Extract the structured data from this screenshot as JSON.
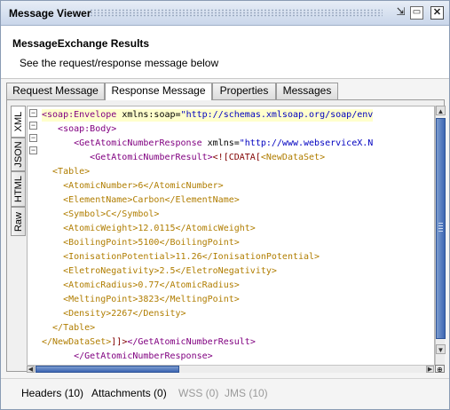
{
  "window": {
    "title": "Message Viewer",
    "detach_glyph": "⇲",
    "maximize_glyph": "▭",
    "close_glyph": "✕"
  },
  "header": {
    "title": "MessageExchange Results",
    "subtitle": "See the request/response message below"
  },
  "tabs": [
    {
      "label": "Request Message",
      "active": false
    },
    {
      "label": "Response Message",
      "active": true
    },
    {
      "label": "Properties",
      "active": false
    },
    {
      "label": "Messages",
      "active": false
    }
  ],
  "view_tabs": [
    {
      "label": "XML",
      "active": true
    },
    {
      "label": "JSON",
      "active": false
    },
    {
      "label": "HTML",
      "active": false
    },
    {
      "label": "Raw",
      "active": false
    }
  ],
  "code_lines": [
    {
      "parts": [
        {
          "c": "tag",
          "t": "<soap:Envelope "
        },
        {
          "c": "attr",
          "t": "xmlns:soap="
        },
        {
          "c": "str",
          "t": "\"http://schemas.xmlsoap.org/soap/env"
        }
      ],
      "highlight": true
    },
    {
      "parts": [
        {
          "c": "tag",
          "t": "   <soap:Body>"
        }
      ]
    },
    {
      "parts": [
        {
          "c": "tag",
          "t": "      <GetAtomicNumberResponse "
        },
        {
          "c": "attr",
          "t": "xmlns="
        },
        {
          "c": "str",
          "t": "\"http://www.webserviceX.N"
        }
      ]
    },
    {
      "parts": [
        {
          "c": "tag",
          "t": "         <GetAtomicNumberResult>"
        },
        {
          "c": "cdata",
          "t": "<![CDATA["
        },
        {
          "c": "xml-inner",
          "t": "<NewDataSet>"
        }
      ]
    },
    {
      "parts": [
        {
          "c": "xml-inner",
          "t": "  <Table>"
        }
      ]
    },
    {
      "parts": [
        {
          "c": "xml-inner",
          "t": "    <AtomicNumber>6</AtomicNumber>"
        }
      ]
    },
    {
      "parts": [
        {
          "c": "xml-inner",
          "t": "    <ElementName>Carbon</ElementName>"
        }
      ]
    },
    {
      "parts": [
        {
          "c": "xml-inner",
          "t": "    <Symbol>C</Symbol>"
        }
      ]
    },
    {
      "parts": [
        {
          "c": "xml-inner",
          "t": "    <AtomicWeight>12.0115</AtomicWeight>"
        }
      ]
    },
    {
      "parts": [
        {
          "c": "xml-inner",
          "t": "    <BoilingPoint>5100</BoilingPoint>"
        }
      ]
    },
    {
      "parts": [
        {
          "c": "xml-inner",
          "t": "    <IonisationPotential>11.26</IonisationPotential>"
        }
      ]
    },
    {
      "parts": [
        {
          "c": "xml-inner",
          "t": "    <EletroNegativity>2.5</EletroNegativity>"
        }
      ]
    },
    {
      "parts": [
        {
          "c": "xml-inner",
          "t": "    <AtomicRadius>0.77</AtomicRadius>"
        }
      ]
    },
    {
      "parts": [
        {
          "c": "xml-inner",
          "t": "    <MeltingPoint>3823</MeltingPoint>"
        }
      ]
    },
    {
      "parts": [
        {
          "c": "xml-inner",
          "t": "    <Density>2267</Density>"
        }
      ]
    },
    {
      "parts": [
        {
          "c": "xml-inner",
          "t": "  </Table>"
        }
      ]
    },
    {
      "parts": [
        {
          "c": "xml-inner",
          "t": "</NewDataSet>"
        },
        {
          "c": "cdata",
          "t": "]]>"
        },
        {
          "c": "tag",
          "t": "</GetAtomicNumberResult>"
        }
      ]
    },
    {
      "parts": [
        {
          "c": "tag",
          "t": "      </GetAtomicNumberResponse>"
        }
      ]
    }
  ],
  "bottom_tabs": [
    {
      "label": "Headers (10)",
      "enabled": true
    },
    {
      "label": "Attachments (0)",
      "enabled": true
    },
    {
      "label": "WSS (0)",
      "enabled": false
    },
    {
      "label": "JMS (10)",
      "enabled": false
    }
  ],
  "colors": {
    "tag": "#800080",
    "string": "#0000c0",
    "cdata": "#800000",
    "inner_xml": "#b07d00",
    "highlight_line": "#ffffcc",
    "scroll_thumb": "#3d66b3"
  }
}
